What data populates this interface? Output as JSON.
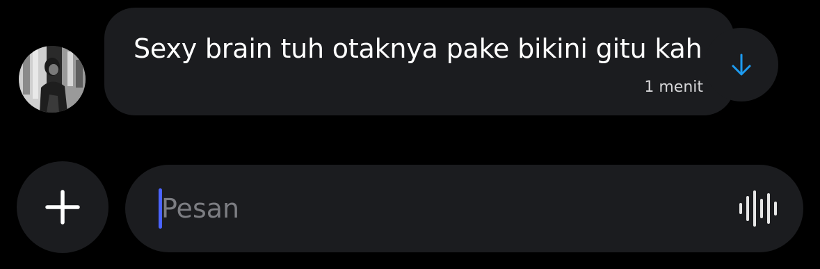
{
  "conversation": {
    "message": {
      "text": "Sexy brain tuh otaknya pake bikini gitu kah",
      "timestamp": "1 menit"
    },
    "scroll_button_icon": "arrow-down-icon"
  },
  "composer": {
    "add_icon": "plus-icon",
    "input_placeholder": "Pesan",
    "input_value": "",
    "voice_icon": "waveform-icon"
  },
  "colors": {
    "background": "#000000",
    "surface": "#1b1c1f",
    "accent": "#1d9bf0",
    "caret": "#4a63ff",
    "placeholder": "#7c7d82"
  }
}
